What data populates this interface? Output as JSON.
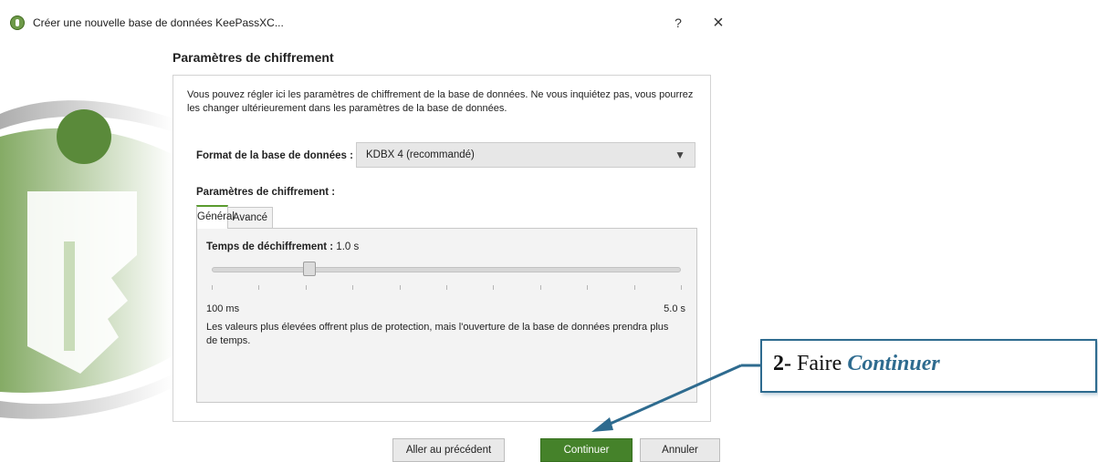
{
  "window": {
    "title": "Créer une nouvelle base de données KeePassXC...",
    "help": "?",
    "close": "×",
    "icon": "keepassxc-logo-icon"
  },
  "page": {
    "heading": "Paramètres de chiffrement",
    "intro": "Vous pouvez régler ici les paramètres de chiffrement de la base de données. Ne vous inquiétez pas, vous pourrez les changer ultérieurement dans les paramètres de la base de données."
  },
  "format": {
    "label": "Format de la base de données :",
    "value": "KDBX 4 (recommandé)",
    "arrow": "▼"
  },
  "encryption": {
    "label": "Paramètres de chiffrement :",
    "tabs": [
      "Général",
      "Avancé"
    ],
    "active_tab": "Général",
    "decrypt_label": "Temps de déchiffrement :",
    "decrypt_value": "1.0 s",
    "slider_value_fraction": 0.2,
    "slider_min": "100 ms",
    "slider_max": "5.0 s",
    "help": "Les valeurs plus élevées offrent plus de protection, mais l'ouverture de la base de données prendra plus de temps."
  },
  "buttons": {
    "back": "Aller au précédent",
    "continue": "Continuer",
    "cancel": "Annuler"
  },
  "annotation": {
    "step": "2-",
    "text": "Faire",
    "emphasis": "Continuer"
  },
  "colors": {
    "accent_green": "#45822a",
    "annotation_blue": "#2e6b8f"
  }
}
